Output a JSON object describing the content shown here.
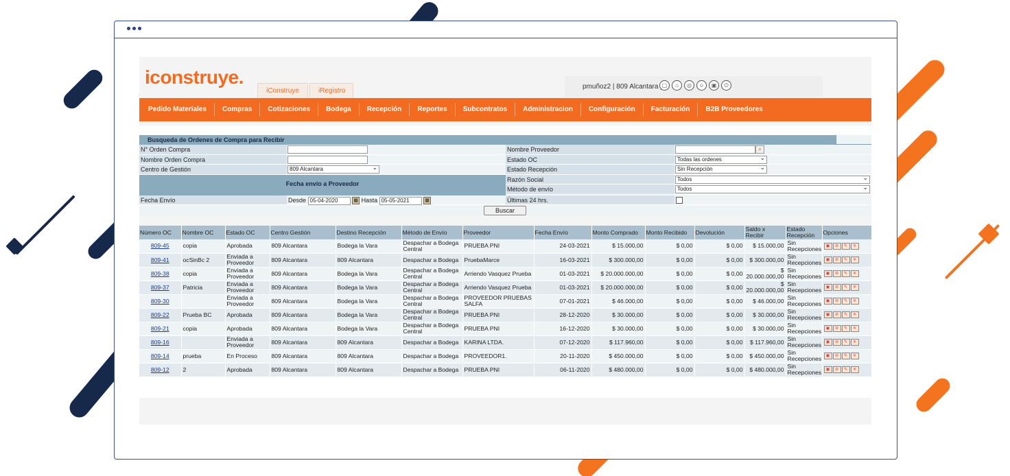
{
  "header": {
    "logo_text": "iconstruye.",
    "tabs": [
      "iConstruye",
      "iRegistro"
    ],
    "user_info": "pmuñoz2 | 809 Alcantara |",
    "user_icons": [
      "document-icon",
      "home-icon",
      "globe-icon",
      "user-icon",
      "lock-icon",
      "power-icon"
    ]
  },
  "nav": [
    "Pedido Materiales",
    "Compras",
    "Cotizaciones",
    "Bodega",
    "Recepción",
    "Reportes",
    "Subcontratos",
    "Administracion",
    "Configuración",
    "Facturación",
    "B2B Proveedores"
  ],
  "search": {
    "title": "Busqueda de Ordenes de Compra para Recibir",
    "labels": {
      "numero_oc": "N° Orden Compra",
      "nombre_oc": "Nombre Orden Compra",
      "centro": "Centro de Gestión",
      "fecha_header": "Fecha envío a Proveedor",
      "fecha_envio": "Fecha Envío",
      "desde": "Desde",
      "hasta": "Hasta",
      "nombre_proveedor": "Nombre Proveedor",
      "estado_oc": "Estado OC",
      "estado_recepcion": "Estado Recepción",
      "razon_social": "Razón Social",
      "metodo_envio": "Método de envío",
      "ultimas": "Últimas 24 hrs."
    },
    "values": {
      "centro": "809 Alcantara",
      "desde": "05-04-2020",
      "hasta": "05-05-2021",
      "estado_oc": "Todas las ordenes",
      "estado_recepcion": "Sin Recepción",
      "razon_social": "Todos",
      "metodo_envio": "Todos"
    },
    "button": "Buscar"
  },
  "table": {
    "headers": [
      "Número OC",
      "Nombre OC",
      "Estado OC",
      "Centro Gestión",
      "Destino Recepción",
      "Método de Envío",
      "Proveedor",
      "Fecha Envío",
      "Monto Comprado",
      "Monto Recibido",
      "Devolución",
      "Saldo x Recibir",
      "Estado Recepción",
      "Opciones"
    ],
    "rows": [
      [
        "809-45",
        "copia",
        "Aprobada",
        "809 Alcantara",
        "Bodega la Vara",
        "Despachar a Bodega Central",
        "PRUEBA PNI",
        "24-03-2021",
        "$ 15.000,00",
        "$ 0,00",
        "$ 0,00",
        "$ 15.000,00",
        "Sin Recepciones"
      ],
      [
        "809-41",
        "ocSinBc 2",
        "Enviada a Proveedor",
        "809 Alcantara",
        "809 Alcantara",
        "Despachar a Bodega",
        "PruebaMarce",
        "16-03-2021",
        "$ 300.000,00",
        "$ 0,00",
        "$ 0,00",
        "$ 300.000,00",
        "Sin Recepciones"
      ],
      [
        "809-38",
        "copia",
        "Enviada a Proveedor",
        "809 Alcantara",
        "Bodega la Vara",
        "Despachar a Bodega Central",
        "Arriendo Vasquez Prueba",
        "01-03-2021",
        "$ 20.000.000,00",
        "$ 0,00",
        "$ 0,00",
        "$ 20.000.000,00",
        "Sin Recepciones"
      ],
      [
        "809-37",
        "Patricia",
        "Enviada a Proveedor",
        "809 Alcantara",
        "Bodega la Vara",
        "Despachar a Bodega Central",
        "Arriendo Vasquez Prueba",
        "01-03-2021",
        "$ 20.000.000,00",
        "$ 0,00",
        "$ 0,00",
        "$ 20.000.000,00",
        "Sin Recepciones"
      ],
      [
        "809-30",
        "",
        "Enviada a Proveedor",
        "809 Alcantara",
        "Bodega la Vara",
        "Despachar a Bodega Central",
        "PROVEEDOR PRUEBAS SALFA",
        "07-01-2021",
        "$ 46.000,00",
        "$ 0,00",
        "$ 0,00",
        "$ 46.000,00",
        "Sin Recepciones"
      ],
      [
        "809-22",
        "Prueba BC",
        "Aprobada",
        "809 Alcantara",
        "Bodega la Vara",
        "Despachar a Bodega Central",
        "PRUEBA PNI",
        "28-12-2020",
        "$ 30.000,00",
        "$ 0,00",
        "$ 0,00",
        "$ 30.000,00",
        "Sin Recepciones"
      ],
      [
        "809-21",
        "copia",
        "Aprobada",
        "809 Alcantara",
        "Bodega la Vara",
        "Despachar a Bodega Central",
        "PRUEBA PNI",
        "16-12-2020",
        "$ 30.000,00",
        "$ 0,00",
        "$ 0,00",
        "$ 30.000,00",
        "Sin Recepciones"
      ],
      [
        "809-16",
        "",
        "Enviada a Proveedor",
        "809 Alcantara",
        "809 Alcantara",
        "Despachar a Bodega",
        "KARINA LTDA.",
        "07-12-2020",
        "$ 117.960,00",
        "$ 0,00",
        "$ 0,00",
        "$ 117.960,00",
        "Sin Recepciones"
      ],
      [
        "809-14",
        "prueba",
        "En Proceso",
        "809 Alcantara",
        "809 Alcantara",
        "Despachar a Bodega",
        "PROVEEDOR1.",
        "20-11-2020",
        "$ 450.000,00",
        "$ 0,00",
        "$ 0,00",
        "$ 450.000,00",
        "Sin Recepciones"
      ],
      [
        "809-12",
        "2",
        "Aprobada",
        "809 Alcantara",
        "809 Alcantara",
        "Despachar a Bodega",
        "PRUEBA PNI",
        "06-11-2020",
        "$ 480.000,00",
        "$ 0,00",
        "$ 0,00",
        "$ 480.000,00",
        "Sin Recepciones"
      ]
    ]
  },
  "colors": {
    "brand_orange": "#f36b21",
    "navy": "#16294a",
    "table_header": "#a9bfce"
  }
}
